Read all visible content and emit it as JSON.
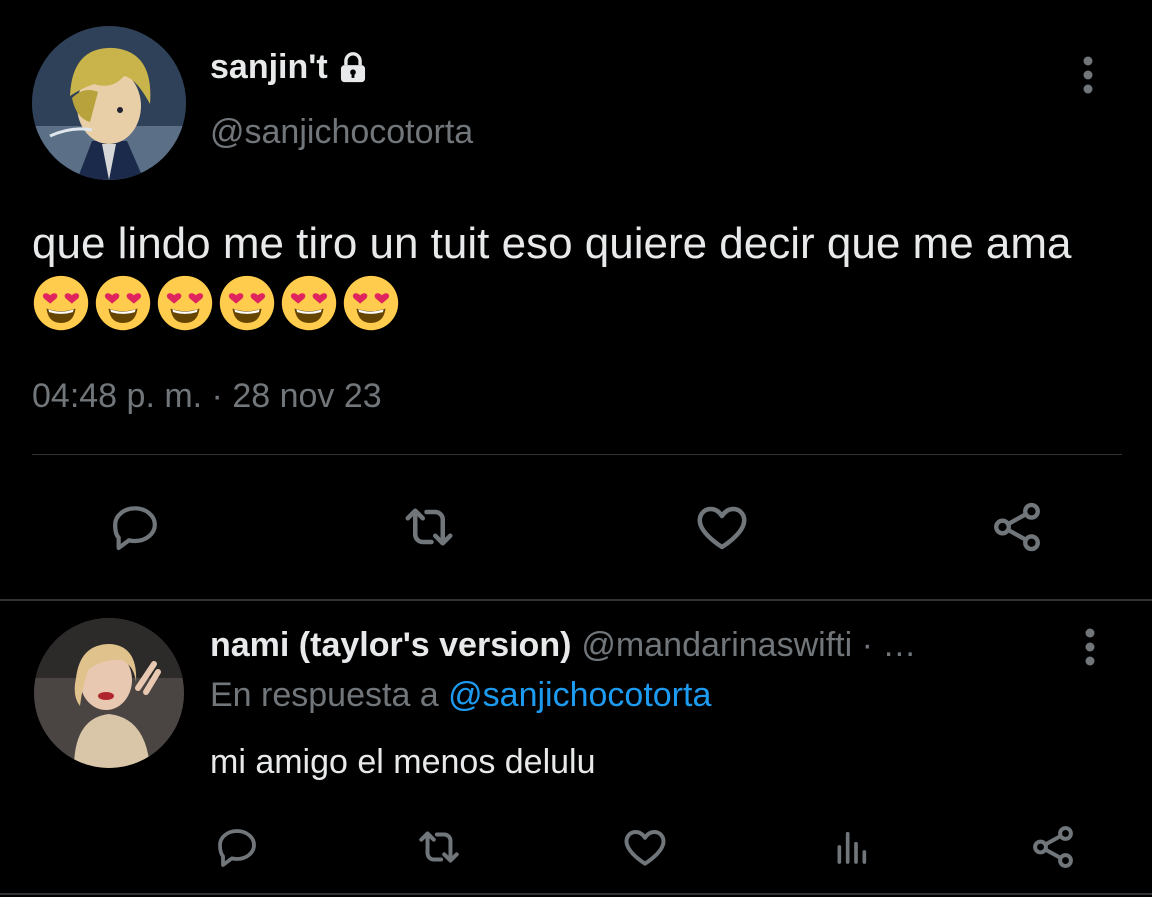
{
  "tweet": {
    "display_name": "sanjin't",
    "handle": "@sanjichocotorta",
    "text": "que lindo me tiro un tuit eso quiere decir que me ama",
    "emoji_count": 6,
    "timestamp": "04:48 p. m. · 28 nov 23",
    "icons": {
      "lock": "lock-icon",
      "more": "more-vertical-icon",
      "reply": "reply-icon",
      "retweet": "retweet-icon",
      "like": "heart-icon",
      "share": "share-icon"
    }
  },
  "reply": {
    "display_name": "nami (taylor's version)",
    "handle_truncated": "@mandarinaswifti · …",
    "reply_prefix": "En respuesta a",
    "reply_to": "@sanjichocotorta",
    "text": "mi amigo el menos delulu",
    "icons": {
      "reply": "reply-icon",
      "retweet": "retweet-icon",
      "like": "heart-icon",
      "views": "analytics-icon",
      "share": "share-icon"
    }
  },
  "colors": {
    "background": "#000000",
    "text": "#e7e9ea",
    "muted": "#71767b",
    "link": "#1d9bf0",
    "divider": "#2f3336"
  }
}
